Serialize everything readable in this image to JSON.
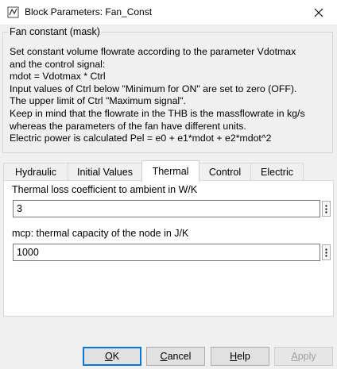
{
  "window": {
    "title": "Block Parameters: Fan_Const"
  },
  "group": {
    "title": "Fan constant (mask)"
  },
  "description": [
    "Set constant volume flowrate according to the parameter Vdotmax",
    "and the control signal:",
    "mdot = Vdotmax * Ctrl",
    "Input values of Ctrl below \"Minimum for ON\" are set to zero (OFF).",
    "The upper limit of Ctrl \"Maximum signal\".",
    "Keep in mind that the flowrate in the THB is the massflowrate in kg/s",
    "whereas the parameters of the fan have different units.",
    "Electric power is calculated Pel = e0 + e1*mdot + e2*mdot^2"
  ],
  "tabs": [
    {
      "label": "Hydraulic"
    },
    {
      "label": "Initial Values"
    },
    {
      "label": "Thermal"
    },
    {
      "label": "Control"
    },
    {
      "label": "Electric"
    }
  ],
  "active_tab": "Thermal",
  "params": [
    {
      "label": "Thermal loss coefficient to ambient in W/K",
      "value": "3"
    },
    {
      "label": "mcp: thermal capacity of the node in J/K",
      "value": "1000"
    }
  ],
  "buttons": {
    "ok": {
      "first": "O",
      "rest": "K"
    },
    "cancel": {
      "first": "C",
      "rest": "ancel"
    },
    "help": {
      "first": "H",
      "rest": "elp"
    },
    "apply": {
      "first": "A",
      "rest": "pply"
    }
  },
  "colors": {
    "default_button_border": "#0078d7",
    "panel_bg": "#ffffff",
    "dialog_bg": "#f0f0f0"
  }
}
